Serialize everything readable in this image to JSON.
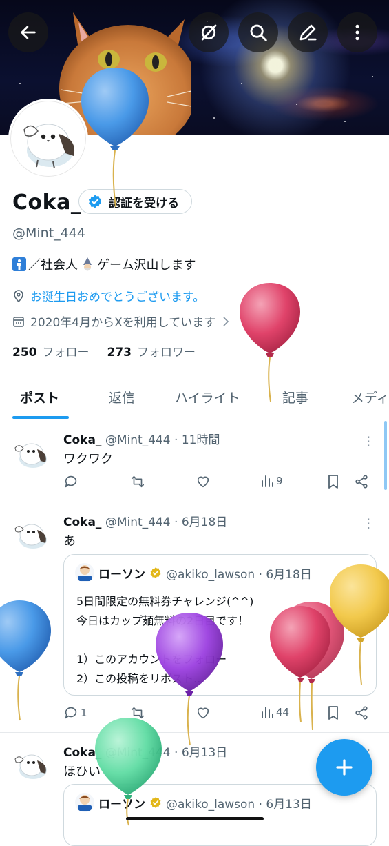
{
  "profile": {
    "display_name": "Coka_",
    "verify_button": "認証を受ける",
    "handle": "@Mint_444",
    "bio": "／社会人",
    "bio_tail": "ゲーム沢山します",
    "birthday_text": "お誕生日おめでとうございます。",
    "joined_text": "2020年4月からXを利用しています",
    "following_count": "250",
    "following_label": "フォロー",
    "followers_count": "273",
    "followers_label": "フォロワー"
  },
  "top_icons": [
    "back-arrow-icon",
    "grok-icon",
    "search-icon",
    "edit-icon",
    "more-vertical-icon"
  ],
  "tabs": [
    {
      "label": "ポスト",
      "active": true
    },
    {
      "label": "返信"
    },
    {
      "label": "ハイライト"
    },
    {
      "label": "記事"
    },
    {
      "label": "メディ"
    }
  ],
  "posts": [
    {
      "name": "Coka_",
      "meta": "@Mint_444 · 11時間",
      "text": "ワクワク",
      "views": "9",
      "replies": ""
    },
    {
      "name": "Coka_",
      "meta": "@Mint_444 · 6月18日",
      "text": "あ",
      "replies": "1",
      "views": "44",
      "quote": {
        "name": "ローソン",
        "meta": "@akiko_lawson · 6月18日",
        "body": "5日間限定の無料券チャレンジ(^^)\n今日はカップ麺無料の2日目です！\n\n1）このアカウントをフォロー\n2）この投稿をリポスト..."
      }
    },
    {
      "name": "Coka_",
      "meta": "@Mint_444 · 6月13日",
      "text": "ほひい",
      "quote": {
        "name": "ローソン",
        "meta": "@akiko_lawson · 6月13日"
      }
    }
  ],
  "colors": {
    "accent": "#1d9bf0",
    "verified_badge": "#1d9bf0",
    "gold_badge": "#e2b719",
    "balloon_blue": "#4a9ae8",
    "balloon_red": "#e0436a",
    "balloon_purple": "#9b3fe0",
    "balloon_yellow": "#f2c94c",
    "balloon_green": "#5fdca3"
  }
}
